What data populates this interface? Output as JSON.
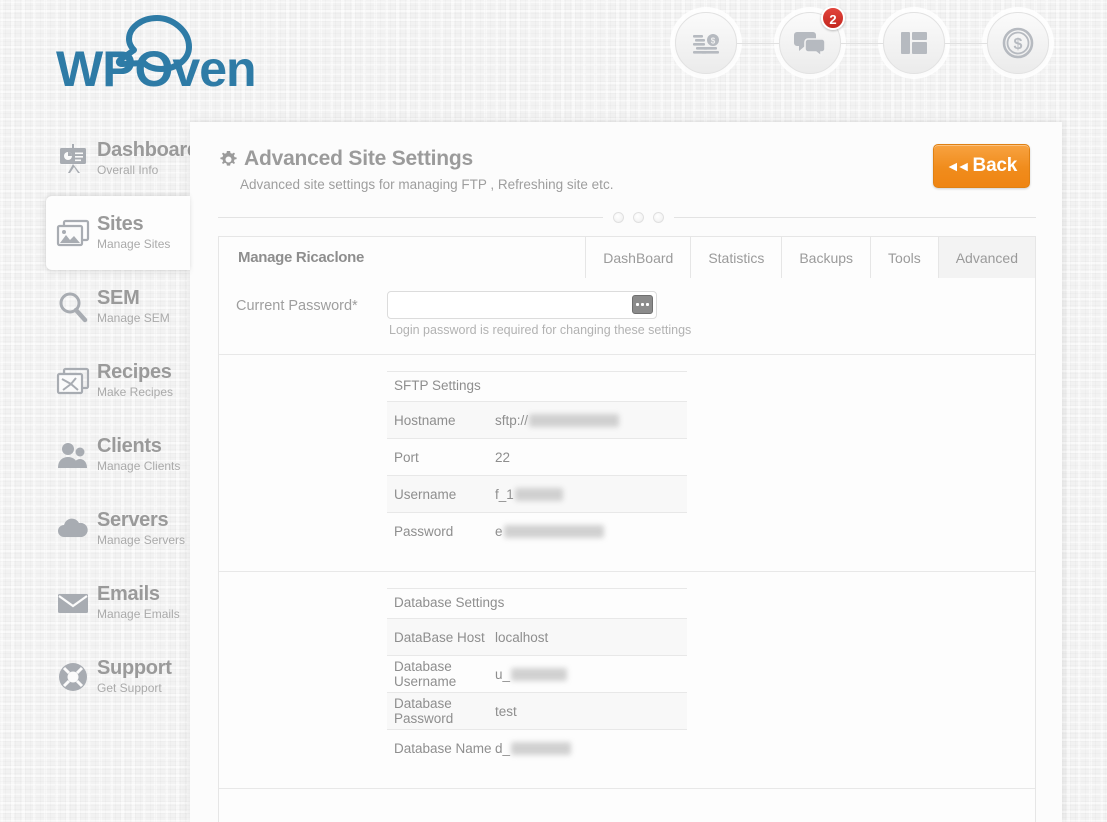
{
  "brand": {
    "name": "WPOven",
    "logo_color": "#2e7ba6"
  },
  "header": {
    "icons": [
      {
        "name": "coins-stack-icon",
        "badge": null
      },
      {
        "name": "chat-bubbles-icon",
        "badge": "2"
      },
      {
        "name": "layout-panels-icon",
        "badge": null
      },
      {
        "name": "dollar-coin-icon",
        "badge": null
      }
    ],
    "badge_color": "#c4271f"
  },
  "sidebar": {
    "items": [
      {
        "icon": "presentation-board-icon",
        "title": "Dashboard",
        "subtitle": "Overall Info",
        "active": false
      },
      {
        "icon": "images-stack-icon",
        "title": "Sites",
        "subtitle": "Manage Sites",
        "active": true
      },
      {
        "icon": "magnifier-icon",
        "title": "SEM",
        "subtitle": "Manage SEM",
        "active": false
      },
      {
        "icon": "recipe-image-icon",
        "title": "Recipes",
        "subtitle": "Make Recipes",
        "active": false
      },
      {
        "icon": "people-icon",
        "title": "Clients",
        "subtitle": "Manage Clients",
        "active": false
      },
      {
        "icon": "cloud-icon",
        "title": "Servers",
        "subtitle": "Manage Servers",
        "active": false
      },
      {
        "icon": "envelope-icon",
        "title": "Emails",
        "subtitle": "Manage Emails",
        "active": false
      },
      {
        "icon": "lifebuoy-icon",
        "title": "Support",
        "subtitle": "Get Support",
        "active": false
      }
    ]
  },
  "page": {
    "title": "Advanced Site Settings",
    "subtitle": "Advanced site settings for managing FTP , Refreshing site etc.",
    "back_label": "Back",
    "back_arrow": "◀◀",
    "back_color": "#f08c1c"
  },
  "tabs": {
    "site_label": "Manage Ricaclone",
    "items": [
      {
        "label": "DashBoard",
        "active": false
      },
      {
        "label": "Statistics",
        "active": false
      },
      {
        "label": "Backups",
        "active": false
      },
      {
        "label": "Tools",
        "active": false
      },
      {
        "label": "Advanced",
        "active": true
      }
    ]
  },
  "password_field": {
    "label": "Current Password*",
    "value": "",
    "placeholder": "",
    "hint": "Login password is required for changing these settings",
    "reveal_icon": "password-reveal-icon"
  },
  "sftp_settings": {
    "title": "SFTP Settings",
    "rows": [
      {
        "key": "Hostname",
        "value": "sftp://",
        "redacted_width": 90
      },
      {
        "key": "Port",
        "value": "22",
        "redacted_width": 0
      },
      {
        "key": "Username",
        "value": "f_1",
        "redacted_width": 48
      },
      {
        "key": "Password",
        "value": "e",
        "redacted_width": 100
      }
    ]
  },
  "database_settings": {
    "title": "Database Settings",
    "rows": [
      {
        "key": "DataBase Host",
        "value": "localhost",
        "redacted_width": 0
      },
      {
        "key": "Database Username",
        "value": "u_",
        "redacted_width": 56
      },
      {
        "key": "Database Password",
        "value": "test",
        "redacted_width": 0
      },
      {
        "key": "Database Name",
        "value": "d_",
        "redacted_width": 60
      }
    ]
  }
}
